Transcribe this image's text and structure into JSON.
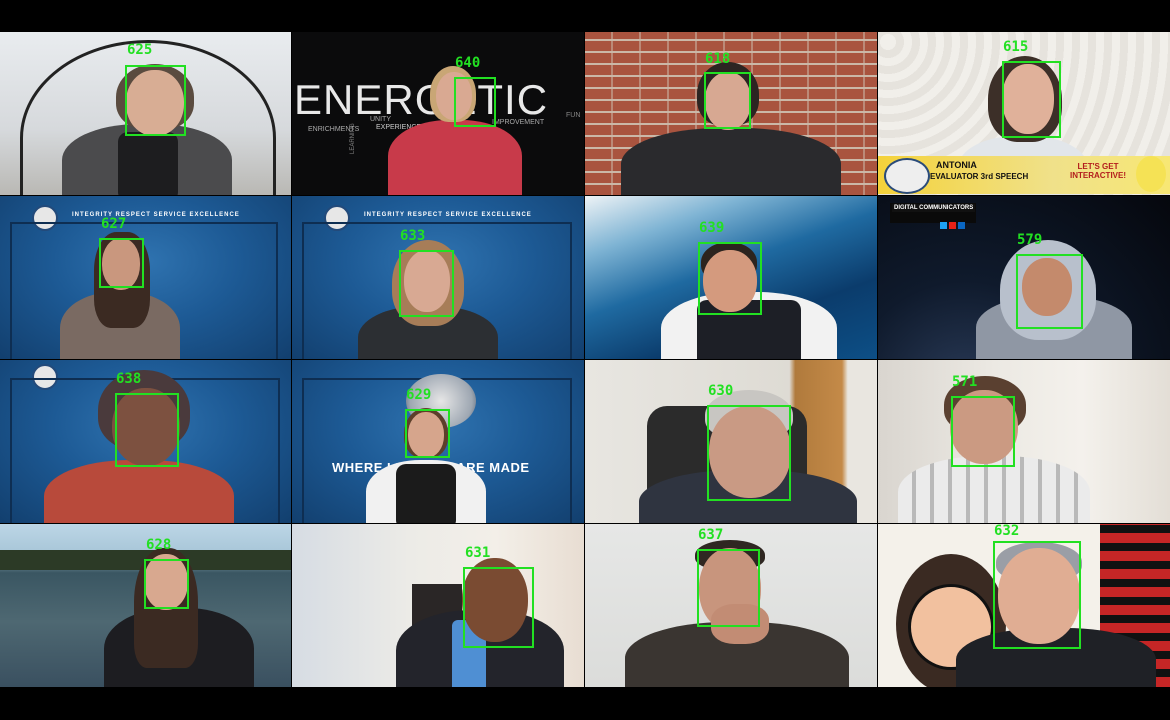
{
  "tiles": [
    {
      "id": "625"
    },
    {
      "id": "640",
      "bg_text": "ENERGETIC",
      "bg_words": [
        "ENRICHMENTS",
        "UNITY",
        "EXPERIENCE",
        "IMPROVEMENT",
        "LEARNING",
        "FUN"
      ]
    },
    {
      "id": "618"
    },
    {
      "id": "615",
      "caption_name": "ANTONIA",
      "caption_role": "EVALUATOR 3rd SPEECH",
      "caption_tag": "LET'S GET INTERACTIVE!"
    },
    {
      "id": "627",
      "motto": "INTEGRITY     RESPECT     SERVICE     EXCELLENCE"
    },
    {
      "id": "633",
      "motto": "INTEGRITY     RESPECT     SERVICE     EXCELLENCE"
    },
    {
      "id": "639"
    },
    {
      "id": "579",
      "banner": "DIGITAL COMMUNICATORS"
    },
    {
      "id": "638"
    },
    {
      "id": "629",
      "slogan": "WHERE LEADERS ARE MADE"
    },
    {
      "id": "630"
    },
    {
      "id": "571"
    },
    {
      "id": "628"
    },
    {
      "id": "631"
    },
    {
      "id": "637"
    },
    {
      "id": "632"
    }
  ],
  "colors": {
    "detection_box": "#22e022",
    "background": "#000000",
    "brand_blue": "#1d5a95"
  }
}
